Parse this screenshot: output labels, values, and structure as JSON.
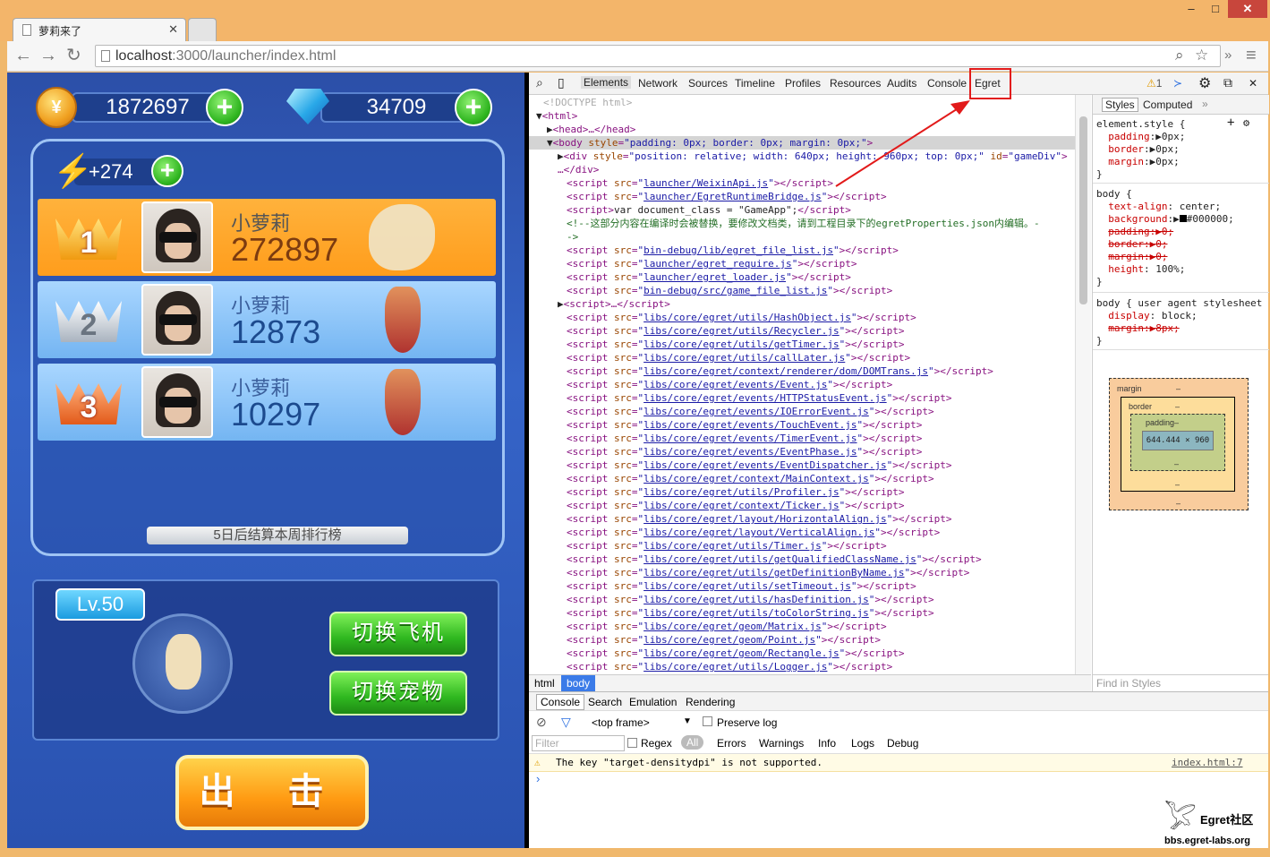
{
  "browser": {
    "tab_title": "萝莉来了",
    "url_host": "localhost",
    "url_rest": ":3000/launcher/index.html",
    "win_minimize": "–",
    "win_maximize": "□",
    "win_close": "✕"
  },
  "game": {
    "coins": "1872697",
    "gems": "34709",
    "energy": "+274",
    "ranking": [
      {
        "rank": "1",
        "name": "小萝莉",
        "score": "272897"
      },
      {
        "rank": "2",
        "name": "小萝莉",
        "score": "12873"
      },
      {
        "rank": "3",
        "name": "小萝莉",
        "score": "10297"
      }
    ],
    "notice": "5日后结算本周排行榜",
    "level": "Lv.50",
    "switch_plane": "切换飞机",
    "switch_pet": "切换宠物",
    "attack": "出 击"
  },
  "devtools": {
    "tabs": [
      "Elements",
      "Network",
      "Sources",
      "Timeline",
      "Profiles",
      "Resources",
      "Audits",
      "Console",
      "Egret"
    ],
    "warn_count": "1",
    "styles_tabs": [
      "Styles",
      "Computed"
    ],
    "breadcrumb": [
      "html",
      "body"
    ],
    "find_in_styles": "Find in Styles",
    "drawer_tabs": [
      "Console",
      "Search",
      "Emulation",
      "Rendering"
    ],
    "frame": "<top frame>",
    "preserve_log": "Preserve log",
    "filter_placeholder": "Filter",
    "regex": "Regex",
    "levels": [
      "All",
      "Errors",
      "Warnings",
      "Info",
      "Logs",
      "Debug"
    ],
    "console_message": "The key \"target-densitydpi\" is not supported.",
    "console_source": "index.html:7",
    "box": {
      "margin": "margin",
      "border": "border",
      "padding": "padding",
      "dash": "–",
      "content": "644.444 × 960"
    }
  },
  "watermark": {
    "name": "Egret社区",
    "site": "bbs.egret-labs.org"
  }
}
